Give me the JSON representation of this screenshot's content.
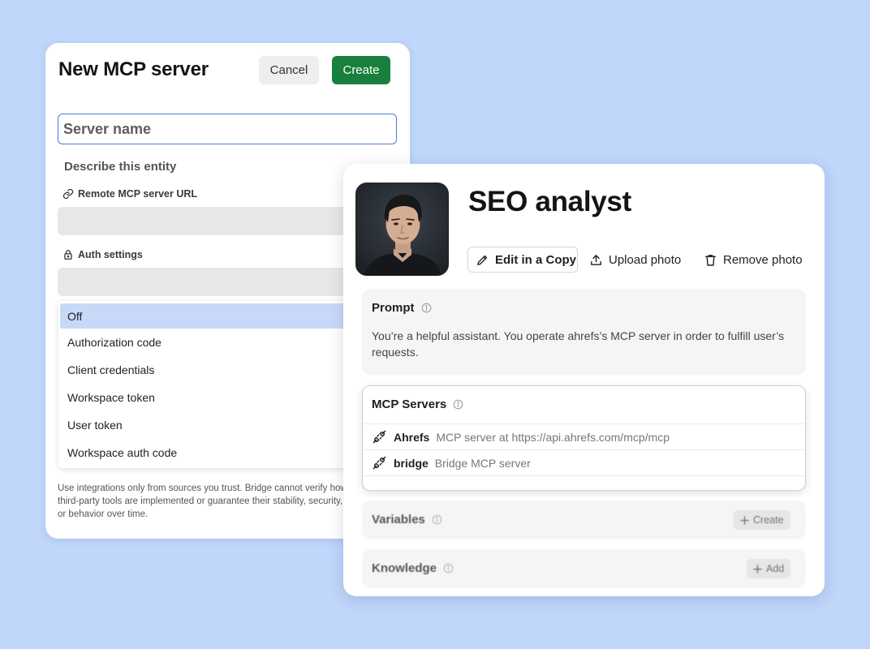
{
  "left_card": {
    "title": "New MCP server",
    "cancel_label": "Cancel",
    "create_label": "Create",
    "name_placeholder": "Server name",
    "describe_label": "Describe this entity",
    "url_label": "Remote MCP server URL",
    "auth_label": "Auth settings",
    "auth_options": [
      "Off",
      "Authorization code",
      "Client credentials",
      "Workspace token",
      "User token",
      "Workspace auth code"
    ],
    "auth_selected": "Off",
    "disclaimer": "Use integrations only from sources you trust. Bridge cannot verify how third-party tools are implemented or guarantee their stability, security, or behavior over time."
  },
  "right_card": {
    "title": "SEO analyst",
    "edit_label": "Edit in a Copy",
    "upload_label": "Upload photo",
    "remove_label": "Remove photo",
    "prompt": {
      "heading": "Prompt",
      "text": "You’re a helpful assistant. You operate ahrefs’s MCP server in order to fulfill user’s requests."
    },
    "mcp": {
      "heading": "MCP Servers",
      "servers": [
        {
          "name": "Ahrefs",
          "desc": "MCP server at https://api.ahrefs.com/mcp/mcp"
        },
        {
          "name": "bridge",
          "desc": "Bridge MCP server"
        }
      ]
    },
    "variables": {
      "heading": "Variables",
      "button": "Create"
    },
    "knowledge": {
      "heading": "Knowledge",
      "button": "Add"
    }
  },
  "icons": {
    "url": "link-icon",
    "auth": "lock-icon",
    "edit": "pencil-icon",
    "upload": "upload-icon",
    "remove": "trash-icon",
    "info": "info-icon",
    "server": "plug-icon",
    "add": "plus-icon"
  },
  "colors": {
    "background": "#c0d6fb",
    "primary_button": "#17803c",
    "input_focus": "#4a7bd6",
    "selected_option": "#c8d9f8"
  }
}
